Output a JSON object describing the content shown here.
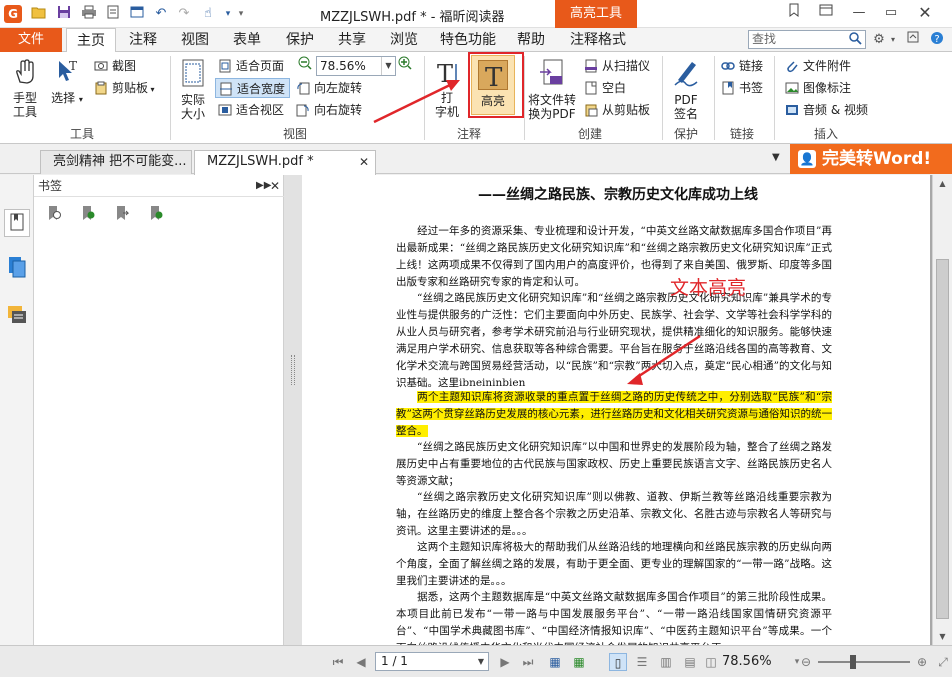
{
  "window": {
    "title": "MZZJLSWH.pdf * - 福昕阅读器",
    "context_tab": "高亮工具"
  },
  "menu": {
    "file": "文件",
    "tabs": [
      "主页",
      "注释",
      "视图",
      "表单",
      "保护",
      "共享",
      "浏览",
      "特色功能",
      "帮助",
      "注释格式"
    ],
    "search_placeholder": "查找"
  },
  "ribbon": {
    "tools": {
      "hand": "手型\n工具",
      "select": "选择",
      "screenshot": "截图",
      "clipboard": "剪贴板",
      "group": "工具"
    },
    "view": {
      "actual_size": "实际\n大小",
      "fit_page": "适合页面",
      "fit_width": "适合宽度",
      "fit_view": "适合视区",
      "zoom_value": "78.56%",
      "rotate_left": "向左旋转",
      "rotate_right": "向右旋转",
      "group": "视图"
    },
    "annotate": {
      "typewriter": "打\n字机",
      "highlight": "高亮",
      "group": "注释"
    },
    "create": {
      "convert_pdf": "将文件转\n换为PDF",
      "from_scanner": "从扫描仪",
      "blank": "空白",
      "from_clipboard": "从剪贴板",
      "group": "创建"
    },
    "protect": {
      "pdf_sign": "PDF\n签名",
      "group": "保护"
    },
    "links": {
      "link": "链接",
      "bookmark": "书签",
      "group": "链接"
    },
    "insert": {
      "attachment": "文件附件",
      "image_annotation": "图像标注",
      "audio_video": "音频 & 视频",
      "group": "插入"
    }
  },
  "doc_tabs": [
    {
      "label": "亮剑精神  把不可能变..."
    },
    {
      "label": "MZZJLSWH.pdf *"
    }
  ],
  "convert_word_label": "完美转Word!",
  "sidebar": {
    "header": "书签"
  },
  "document": {
    "heading": "——丝绸之路民族、宗教历史文化库成功上线",
    "annotation_text": "文本高亮",
    "paragraphs": [
      {
        "text": "经过一年多的资源采集、专业梳理和设计开发，“中英文丝路文献数据库多国合作项目”再出最新成果：“丝绸之路民族历史文化研究知识库”和“丝绸之路宗教历史文化研究知识库”正式上线！这两项成果不仅得到了国内用户的高度评价，也得到了来自美国、俄罗斯、印度等多国出版专家和丝路研究专家的肯定和认可。",
        "highlight": false
      },
      {
        "text": "“丝绸之路民族历史文化研究知识库”和“丝绸之路宗教历史文化研究知识库”兼具学术的专业性与提供服务的广泛性：它们主要面向中外历史、民族学、社会学、文学等社会科学学科的从业人员与研究者，参考学术研究前沿与行业研究现状，提供精准细化的知识服务。能够快速满足用户学术研究、信息获取等各种综合需要。平台旨在服务于丝路沿线各国的高等教育、文化学术交流与跨国贸易经营活动，以“民族”和“宗教”两大切入点，奠定“民心相通”的文化与知识基础。这里ibneininbien",
        "highlight": false
      },
      {
        "text": "两个主题知识库将资源收录的重点置于丝绸之路的历史传统之中，分别选取“民族”和“宗教”这两个贯穿丝路历史发展的核心元素，进行丝路历史和文化相关研究资源与通俗知识的统一整合。",
        "highlight": true
      },
      {
        "text": "“丝绸之路民族历史文化研究知识库”以中国和世界史的发展阶段为轴，整合了丝绸之路发展历史中占有重要地位的古代民族与国家政权、历史上重要民族语言文字、丝路民族历史名人等资源文献；",
        "highlight": false
      },
      {
        "text": "“丝绸之路宗教历史文化研究知识库”则以佛教、道教、伊斯兰教等丝路沿线重要宗教为轴，在丝路历史的维度上整合各个宗教之历史沿革、宗教文化、名胜古迹与宗教名人等研究与资讯。这里主要讲述的是。。。",
        "highlight": false
      },
      {
        "text": "这两个主题知识库将极大的帮助我们从丝路沿线的地理横向和丝路民族宗教的历史纵向两个角度，全面了解丝绸之路的发展，有助于更全面、更专业的理解国家的“一带一路”战略。这里我们主要讲述的是。。。",
        "highlight": false
      },
      {
        "text": "据悉，这两个主题数据库是“中英文丝路文献数据库多国合作项目”的第三批阶段性成果。本项目此前已发布“一带一路与中国发展服务平台”、“一带一路沿线国家国情研究资源平台”、“中国学术典藏图书库”、“中国经济情报知识库”、“中医药主题知识平台”等成果。一个面向丝路沿线传播中华文化和当代中国经济社会发展的知识共享平台正",
        "highlight": false
      }
    ]
  },
  "status": {
    "page_value": "1 / 1",
    "zoom": "78.56%",
    "zoom_slider_fraction": 0.38
  },
  "colors": {
    "accent": "#e8591a",
    "highlight": "#ffee00",
    "annotation_red": "#e0262a"
  }
}
